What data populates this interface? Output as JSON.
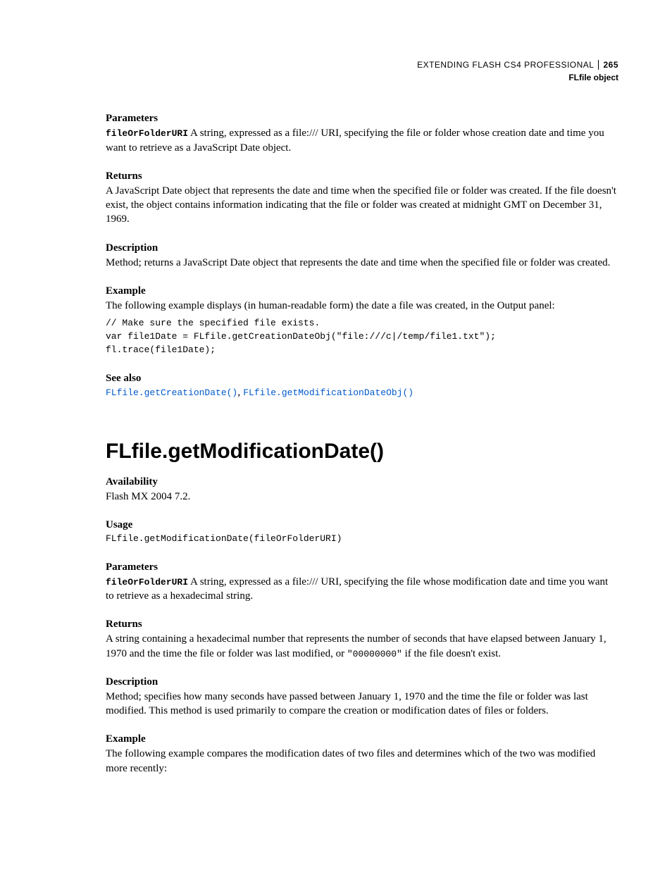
{
  "header": {
    "doc_title": "EXTENDING FLASH CS4 PROFESSIONAL",
    "page_number": "265",
    "chapter": "FLfile object"
  },
  "s1": {
    "parameters_h": "Parameters",
    "param_name": "fileOrFolderURI",
    "param_desc": "  A string, expressed as a file:/// URI, specifying the file or folder whose creation date and time you want to retrieve as a JavaScript Date object.",
    "returns_h": "Returns",
    "returns_body": "A JavaScript Date object that represents the date and time when the specified file or folder was created. If the file doesn't exist, the object contains information indicating that the file or folder was created at midnight GMT on December 31, 1969.",
    "description_h": "Description",
    "description_body": "Method; returns a JavaScript Date object that represents the date and time when the specified file or folder was created.",
    "example_h": "Example",
    "example_intro": "The following example displays (in human-readable form) the date a file was created, in the Output panel:",
    "code": "// Make sure the specified file exists.\nvar file1Date = FLfile.getCreationDateObj(\"file:///c|/temp/file1.txt\");\nfl.trace(file1Date);",
    "seealso_h": "See also",
    "link1": "FLfile.getCreationDate()",
    "comma": ", ",
    "link2": "FLfile.getModificationDateObj()"
  },
  "s2": {
    "title": "FLfile.getModificationDate()",
    "availability_h": "Availability",
    "availability_body": "Flash MX 2004 7.2.",
    "usage_h": "Usage",
    "usage_code": "FLfile.getModificationDate(fileOrFolderURI)",
    "parameters_h": "Parameters",
    "param_name": "fileOrFolderURI",
    "param_desc": "  A string, expressed as a file:/// URI, specifying the file whose modification date and time you want to retrieve as a hexadecimal string.",
    "returns_h": "Returns",
    "returns_pre": "A string containing a hexadecimal number that represents the number of seconds that have elapsed between January 1, 1970 and the time the file or folder was last modified, or ",
    "returns_code": "\"00000000\"",
    "returns_post": " if the file doesn't exist.",
    "description_h": "Description",
    "description_body": "Method; specifies how many seconds have passed between January 1, 1970 and the time the file or folder was last modified. This method is used primarily to compare the creation or modification dates of files or folders.",
    "example_h": "Example",
    "example_intro": "The following example compares the modification dates of two files and determines which of the two was modified more recently:"
  }
}
